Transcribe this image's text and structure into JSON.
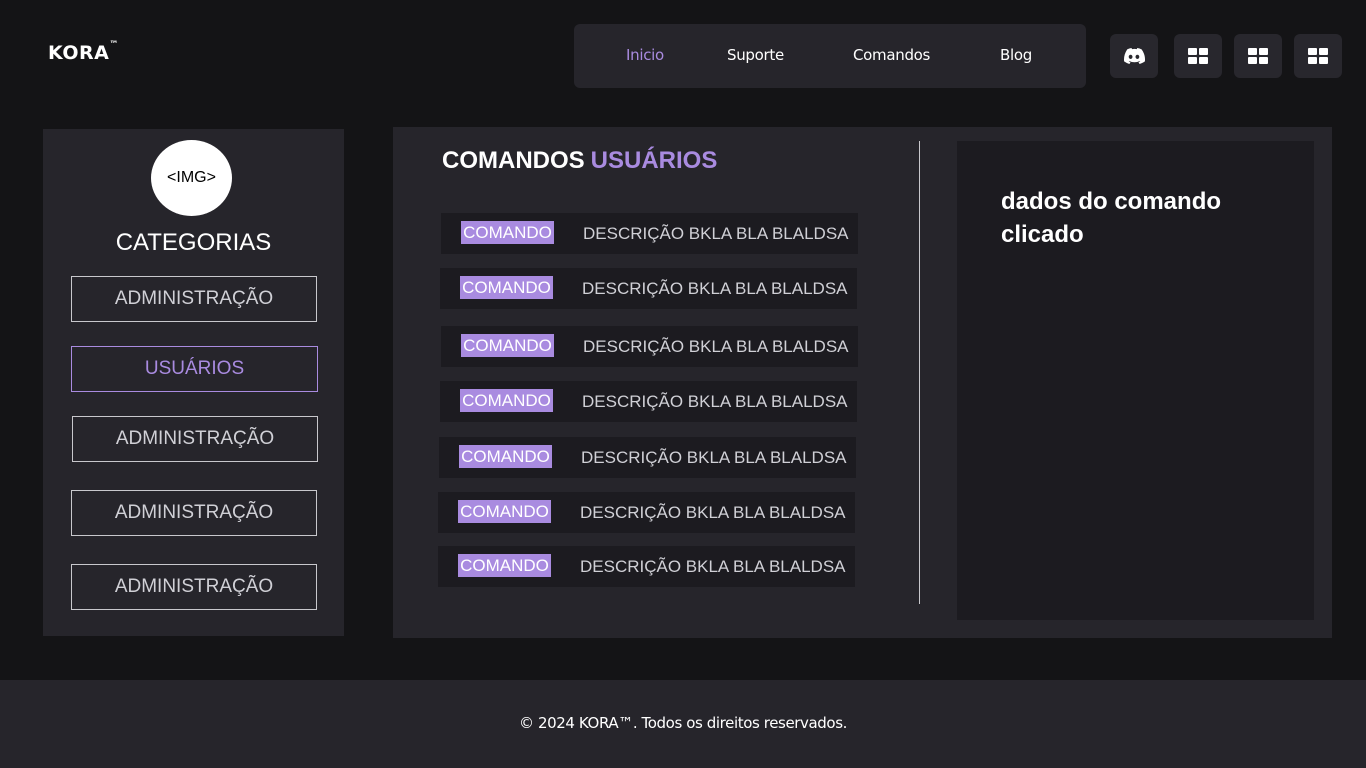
{
  "header": {
    "logo": "KORA",
    "logo_mark": "™",
    "nav": [
      {
        "label": "Inicio",
        "active": true
      },
      {
        "label": "Suporte",
        "active": false
      },
      {
        "label": "Comandos",
        "active": false
      },
      {
        "label": "Blog",
        "active": false
      }
    ],
    "icons": [
      "discord-icon",
      "grid-icon",
      "grid-icon",
      "grid-icon"
    ]
  },
  "sidebar": {
    "avatar_placeholder": "<IMG>",
    "title": "CATEGORIAS",
    "items": [
      {
        "label": "ADMINISTRAÇÃO",
        "active": false
      },
      {
        "label": "USUÁRIOS",
        "active": true
      },
      {
        "label": "ADMINISTRAÇÃO",
        "active": false
      },
      {
        "label": "ADMINISTRAÇÃO",
        "active": false
      },
      {
        "label": "ADMINISTRAÇÃO",
        "active": false
      }
    ]
  },
  "main": {
    "title": "COMANDOS",
    "title_accent": "USUÁRIOS",
    "commands": [
      {
        "name": "COMANDO",
        "description": "DESCRIÇÃO BKLA BLA BLALDSA"
      },
      {
        "name": "COMANDO",
        "description": "DESCRIÇÃO BKLA BLA BLALDSA"
      },
      {
        "name": "COMANDO",
        "description": "DESCRIÇÃO BKLA BLA BLALDSA"
      },
      {
        "name": "COMANDO",
        "description": "DESCRIÇÃO BKLA BLA BLALDSA"
      },
      {
        "name": "COMANDO",
        "description": "DESCRIÇÃO BKLA BLA BLALDSA"
      },
      {
        "name": "COMANDO",
        "description": "DESCRIÇÃO BKLA BLA BLALDSA"
      },
      {
        "name": "COMANDO",
        "description": "DESCRIÇÃO BKLA BLA BLALDSA"
      }
    ],
    "detail_text": "dados do comando clicado"
  },
  "footer": {
    "text": "© 2024 KORA™. Todos os direitos reservados."
  },
  "colors": {
    "background": "#141416",
    "panel": "#26252b",
    "row": "#1c1b20",
    "accent": "#a98be0"
  }
}
